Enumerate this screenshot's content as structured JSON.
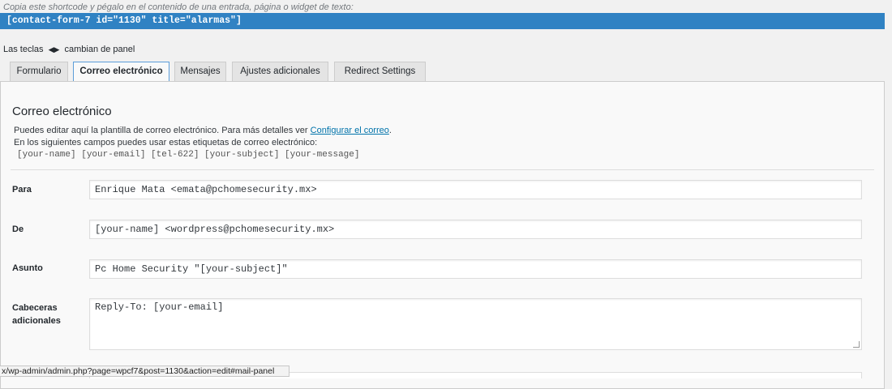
{
  "shortcode": {
    "hint": "Copia este shortcode y pégalo en el contenido de una entrada, página o widget de texto:",
    "code": "[contact-form-7 id=\"1130\" title=\"alarmas\"]"
  },
  "keys_hint": {
    "prefix": "Las teclas",
    "arrows": "◀▶",
    "suffix": "cambian de panel"
  },
  "tabs": [
    {
      "label": "Formulario",
      "active": false
    },
    {
      "label": "Correo electrónico",
      "active": true
    },
    {
      "label": "Mensajes",
      "active": false
    },
    {
      "label": "Ajustes adicionales",
      "active": false
    },
    {
      "label": "Redirect Settings",
      "active": false
    }
  ],
  "panel": {
    "title": "Correo electrónico",
    "desc1_text": "Puedes editar aquí la plantilla de correo electrónico. Para más detalles ver ",
    "desc1_link": "Configurar el correo",
    "desc1_end": ".",
    "desc2": "En los siguientes campos puedes usar estas etiquetas de correo electrónico:",
    "tags": "[your-name] [your-email] [tel-622] [your-subject] [your-message]"
  },
  "fields": {
    "para": {
      "label": "Para",
      "value": "Enrique Mata <emata@pchomesecurity.mx>"
    },
    "de": {
      "label": "De",
      "value": "[your-name] <wordpress@pchomesecurity.mx>"
    },
    "asunto": {
      "label": "Asunto",
      "value": "Pc Home Security \"[your-subject]\""
    },
    "cabeceras": {
      "label_line1": "Cabeceras",
      "label_line2": "adicionales",
      "value": "Reply-To: [your-email]"
    }
  },
  "statusbar": {
    "url": "x/wp-admin/admin.php?page=wpcf7&post=1130&action=edit#mail-panel"
  },
  "colors": {
    "shortcode_bg": "#3082c3",
    "link": "#0073aa",
    "active_tab_border": "#5b9dd9"
  }
}
